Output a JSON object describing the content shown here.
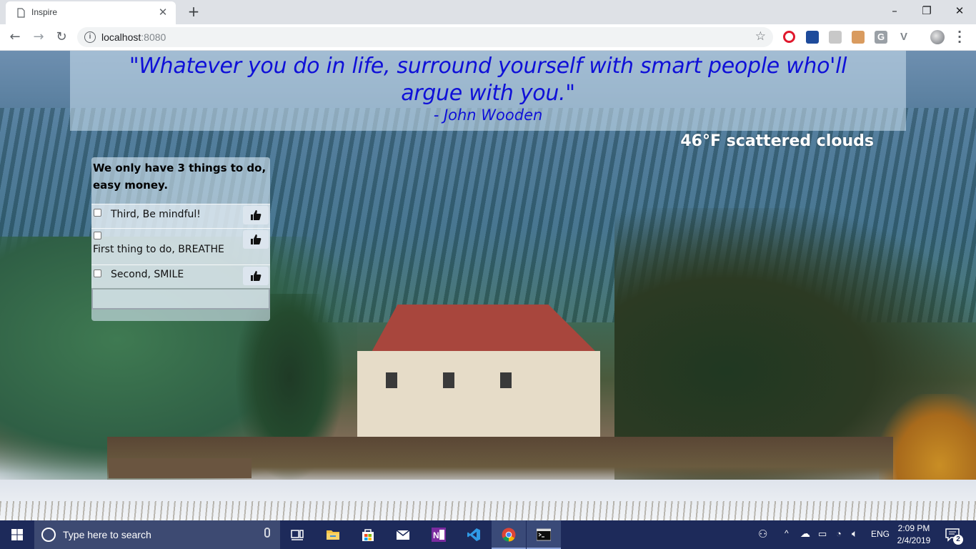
{
  "browser": {
    "tab_title": "Inspire",
    "url_host": "localhost",
    "url_port": ":8080",
    "window_controls": [
      "–",
      "❐",
      "✕"
    ]
  },
  "quote": {
    "text": "\"Whatever you do in life, surround yourself with smart people who'll argue with you.\"",
    "author": "- John Wooden",
    "color": "#0f10d8"
  },
  "weather": {
    "text": "46°F scattered clouds"
  },
  "todo": {
    "heading": "We only have 3 things to do, easy money.",
    "items": [
      {
        "label": "Third, Be mindful!",
        "checked": false
      },
      {
        "label": "First thing to do, BREATHE",
        "checked": false
      },
      {
        "label": "Second, SMILE",
        "checked": false
      }
    ],
    "input_value": ""
  },
  "taskbar": {
    "search_placeholder": "Type here to search",
    "language": "ENG",
    "time": "2:09 PM",
    "date": "2/4/2019",
    "notification_count": "2",
    "pinned_apps": [
      "task-view",
      "file-explorer",
      "store",
      "mail",
      "onenote",
      "vscode",
      "chrome",
      "terminal"
    ]
  }
}
